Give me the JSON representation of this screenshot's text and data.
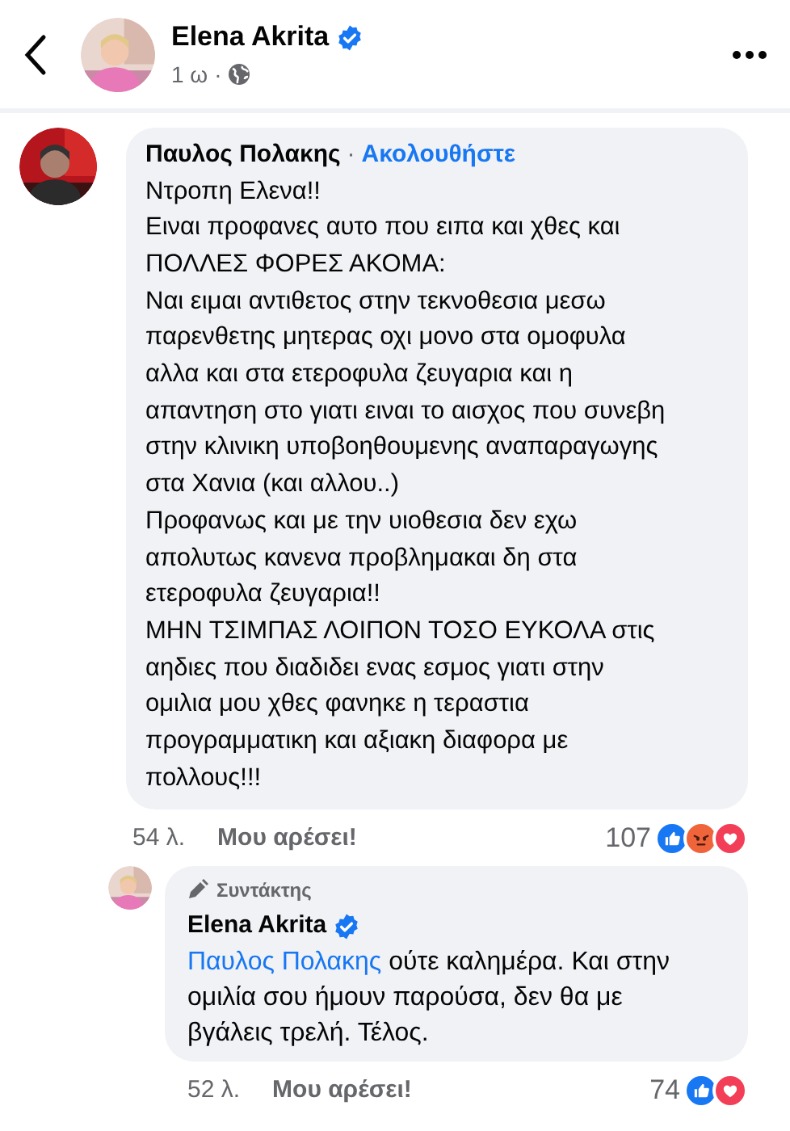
{
  "header": {
    "name": "Elena Akrita",
    "verified": true,
    "time": "1 ω",
    "separator": "·"
  },
  "comment": {
    "author": "Παυλος Πολακης",
    "separator": "·",
    "follow": "Ακολουθήστε",
    "lines": [
      "Ντροπη Ελενα!!",
      "Ειναι προφανες αυτο που ειπα και χθες και",
      "ΠΟΛΛΕΣ ΦΟΡΕΣ ΑΚΟΜΑ:",
      "Ναι ειμαι αντιθετος στην τεκνοθεσια μεσω",
      "παρενθετης μητερας οχι μονο στα ομοφυλα",
      "αλλα και στα ετεροφυλα ζευγαρια και η",
      "απαντηση στο γιατι ειναι το αισχος που συνεβη",
      "στην κλινικη υποβοηθουμενης αναπαραγωγης",
      "στα Χανια (και αλλου..)",
      "Προφανως και με την υιοθεσια δεν εχω",
      "απολυτως κανενα προβλημακαι δη στα",
      "ετεροφυλα ζευγαρια!!",
      "ΜΗΝ ΤΣΙΜΠΑΣ ΛΟΙΠΟΝ ΤΟΣΟ ΕΥΚΟΛΑ στις",
      "αηδιες που διαδιδει ενας εσμος γιατι στην",
      "ομιλια μου χθες φανηκε η τεραστια",
      "προγραμματικη και αξιακη διαφορα με",
      "πολλους!!!"
    ],
    "age": "54 λ.",
    "like": "Μου αρέσει!",
    "count": "107",
    "reactions": [
      {
        "kind": "like"
      },
      {
        "kind": "angry"
      },
      {
        "kind": "love"
      }
    ]
  },
  "reply": {
    "badge": "Συντάκτης",
    "author": "Elena Akrita",
    "verified": true,
    "mention": "Παυλος Πολακης",
    "text": "ούτε καλημέρα. Και στην ομιλία σου ήμουν παρούσα, δεν θα με βγάλεις τρελή. Τέλος.",
    "age": "52 λ.",
    "like": "Μου αρέσει!",
    "count": "74",
    "reactions": [
      {
        "kind": "like"
      },
      {
        "kind": "love"
      }
    ]
  }
}
